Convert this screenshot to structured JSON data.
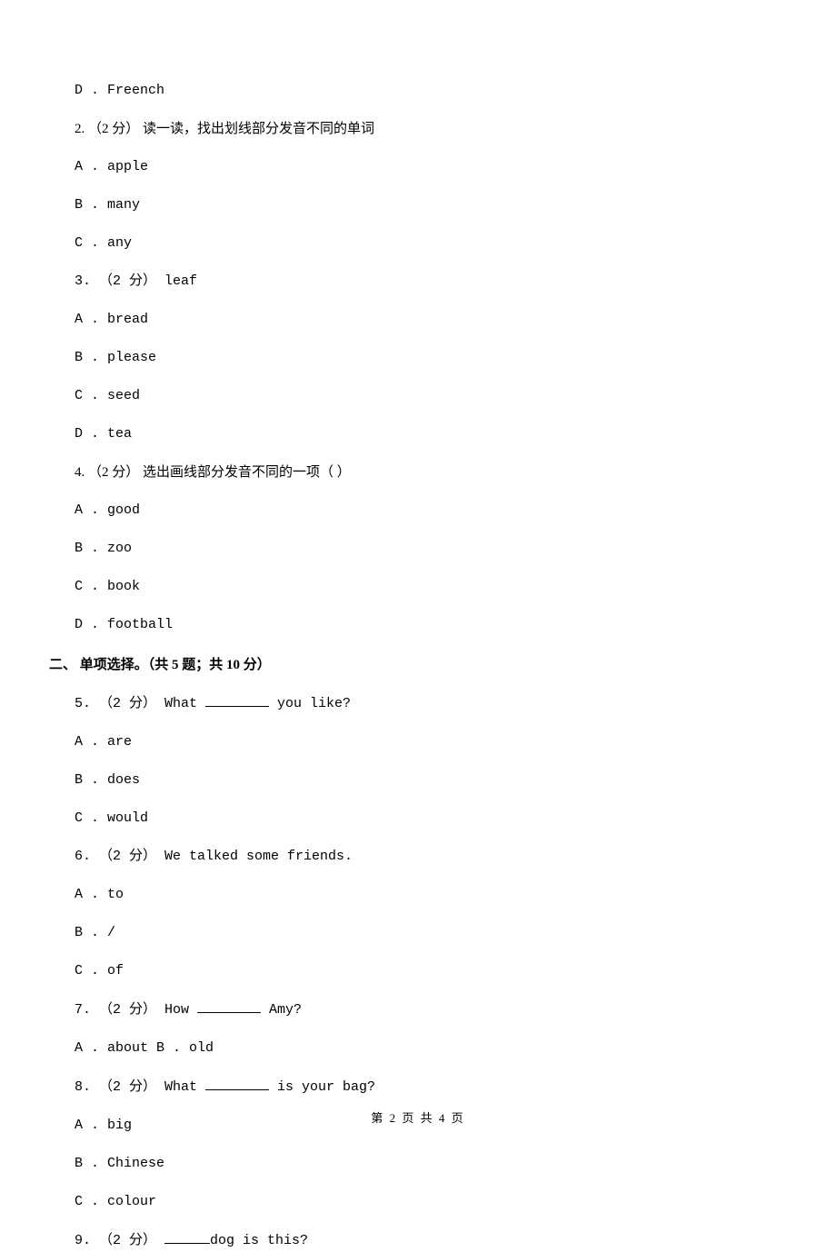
{
  "q1_opt_d": "D . Freench",
  "q2": "2. （2 分） 读一读，找出划线部分发音不同的单词",
  "q2_a": "A . apple",
  "q2_b": "B . many",
  "q2_c": "C . any",
  "q3": "3. （2 分） leaf",
  "q3_a": "A . bread",
  "q3_b": "B . please",
  "q3_c": "C . seed",
  "q3_d": "D . tea",
  "q4": "4. （2 分） 选出画线部分发音不同的一项（   ）",
  "q4_a": "A . good",
  "q4_b": "B . zoo",
  "q4_c": "C . book",
  "q4_d": "D . football",
  "section2": "二、 单项选择。（共 5 题；共 10 分）",
  "q5_pre": "5. （2 分） What ",
  "q5_post": " you like?",
  "q5_a": "A . are",
  "q5_b": "B . does",
  "q5_c": "C . would",
  "q6": "6. （2 分） We talked          some friends.",
  "q6_a": "A . to",
  "q6_b": "B . /",
  "q6_c": "C . of",
  "q7_pre": "7. （2 分） How ",
  "q7_post": " Amy?",
  "q7_a": "A . about        B . old",
  "q8_pre": "8. （2 分） What ",
  "q8_post": " is your bag?",
  "q8_a": "A . big",
  "q8_b": "B . Chinese",
  "q8_c": "C . colour",
  "q9_pre": "9. （2 分） ",
  "q9_post": "dog is this?",
  "footer": "第 2 页 共 4 页"
}
